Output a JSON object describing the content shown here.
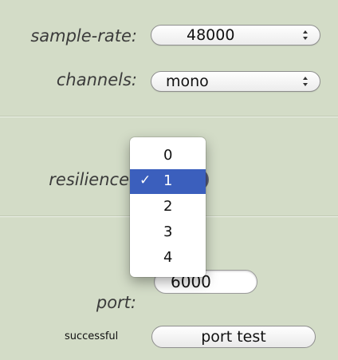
{
  "settings": {
    "sample_rate": {
      "label": "sample-rate:",
      "value": "48000"
    },
    "channels": {
      "label": "channels:",
      "value": "mono"
    },
    "resilience": {
      "label": "resilience",
      "selected": "1",
      "options": [
        "0",
        "1",
        "2",
        "3",
        "4"
      ],
      "check_mark": "✓"
    },
    "port": {
      "label": "port:",
      "value": "6000"
    },
    "port_test": {
      "status": "successful",
      "button_label": "port test"
    }
  },
  "colors": {
    "background": "#d3dcc7",
    "selection_highlight": "#3b5fbd"
  }
}
